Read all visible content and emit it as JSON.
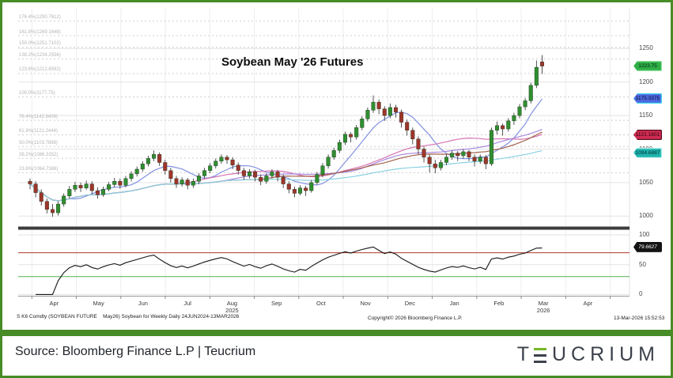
{
  "title": "Soybean May '26 Futures",
  "chart_data": {
    "type": "candlestick",
    "title": "Soybean May '26 Futures",
    "instrument": "S K6 Comdty (SOYBEAN FUTURE)",
    "x_axis": {
      "months": [
        "Apr",
        "May",
        "Jun",
        "Jul",
        "Aug",
        "Sep",
        "Oct",
        "Nov",
        "Dec",
        "Jan",
        "Feb",
        "Mar",
        "Apr"
      ],
      "year_markers": [
        {
          "label": "2025",
          "month_index": 4
        },
        {
          "label": "2026",
          "month_index": 11
        }
      ]
    },
    "y_axis": {
      "ticks": [
        1250,
        1200,
        1150,
        1100,
        1050,
        1000
      ],
      "side": "right"
    },
    "fib_levels": [
      {
        "label": "176.4%(1290.7612)",
        "value": 1290.7612
      },
      {
        "label": "161.8%(1269.1648)",
        "value": 1269.1648
      },
      {
        "label": "150.0%(1251.7102)",
        "value": 1251.7102
      },
      {
        "label": "138.2%(1234.2556)",
        "value": 1234.2556
      },
      {
        "label": "123.6%(1212.6592)",
        "value": 1212.6592
      },
      {
        "label": "100.0%(1177.75)",
        "value": 1177.75
      },
      {
        "label": "76.4%(1142.8408)",
        "value": 1142.8408
      },
      {
        "label": "61.8%(1121.2444)",
        "value": 1121.2444
      },
      {
        "label": "50.0%(1103.7898)",
        "value": 1103.7898
      },
      {
        "label": "38.2%(1086.3352)",
        "value": 1086.3352
      },
      {
        "label": "23.6%(1064.7388)",
        "value": 1064.7388
      }
    ],
    "candle_colors": {
      "up": "#2f8f2f",
      "down": "#9e352a",
      "wick": "#2a2a2a"
    },
    "candles": [
      [
        1052,
        1056,
        1040,
        1048
      ],
      [
        1048,
        1052,
        1028,
        1035
      ],
      [
        1035,
        1040,
        1016,
        1022
      ],
      [
        1022,
        1026,
        1004,
        1010
      ],
      [
        1010,
        1018,
        999,
        1005
      ],
      [
        1005,
        1022,
        1001,
        1018
      ],
      [
        1018,
        1034,
        1014,
        1030
      ],
      [
        1030,
        1045,
        1026,
        1040
      ],
      [
        1040,
        1051,
        1036,
        1046
      ],
      [
        1046,
        1050,
        1036,
        1042
      ],
      [
        1042,
        1053,
        1039,
        1048
      ],
      [
        1048,
        1052,
        1033,
        1038
      ],
      [
        1038,
        1043,
        1026,
        1032
      ],
      [
        1032,
        1044,
        1029,
        1040
      ],
      [
        1040,
        1051,
        1037,
        1047
      ],
      [
        1047,
        1057,
        1043,
        1052
      ],
      [
        1052,
        1056,
        1041,
        1046
      ],
      [
        1046,
        1060,
        1043,
        1056
      ],
      [
        1056,
        1067,
        1052,
        1063
      ],
      [
        1063,
        1074,
        1059,
        1070
      ],
      [
        1070,
        1082,
        1066,
        1078
      ],
      [
        1078,
        1090,
        1074,
        1086
      ],
      [
        1086,
        1098,
        1082,
        1092
      ],
      [
        1092,
        1095,
        1075,
        1080
      ],
      [
        1080,
        1084,
        1062,
        1068
      ],
      [
        1068,
        1072,
        1050,
        1056
      ],
      [
        1056,
        1060,
        1042,
        1048
      ],
      [
        1048,
        1058,
        1044,
        1054
      ],
      [
        1054,
        1057,
        1040,
        1046
      ],
      [
        1046,
        1056,
        1042,
        1052
      ],
      [
        1052,
        1064,
        1048,
        1060
      ],
      [
        1060,
        1072,
        1056,
        1068
      ],
      [
        1068,
        1079,
        1064,
        1075
      ],
      [
        1075,
        1086,
        1071,
        1082
      ],
      [
        1082,
        1092,
        1078,
        1088
      ],
      [
        1088,
        1091,
        1078,
        1084
      ],
      [
        1084,
        1088,
        1070,
        1076
      ],
      [
        1076,
        1080,
        1062,
        1068
      ],
      [
        1068,
        1072,
        1054,
        1060
      ],
      [
        1060,
        1070,
        1056,
        1066
      ],
      [
        1066,
        1069,
        1052,
        1058
      ],
      [
        1058,
        1062,
        1046,
        1052
      ],
      [
        1052,
        1064,
        1048,
        1060
      ],
      [
        1060,
        1070,
        1056,
        1066
      ],
      [
        1066,
        1069,
        1052,
        1058
      ],
      [
        1058,
        1062,
        1042,
        1048
      ],
      [
        1048,
        1052,
        1034,
        1040
      ],
      [
        1040,
        1044,
        1028,
        1034
      ],
      [
        1034,
        1046,
        1031,
        1042
      ],
      [
        1042,
        1045,
        1030,
        1038
      ],
      [
        1038,
        1054,
        1035,
        1050
      ],
      [
        1050,
        1066,
        1047,
        1062
      ],
      [
        1062,
        1079,
        1058,
        1075
      ],
      [
        1075,
        1092,
        1071,
        1088
      ],
      [
        1088,
        1102,
        1084,
        1098
      ],
      [
        1098,
        1114,
        1094,
        1110
      ],
      [
        1110,
        1126,
        1106,
        1122
      ],
      [
        1122,
        1125,
        1110,
        1118
      ],
      [
        1118,
        1136,
        1114,
        1132
      ],
      [
        1132,
        1149,
        1128,
        1145
      ],
      [
        1145,
        1162,
        1141,
        1158
      ],
      [
        1158,
        1180,
        1154,
        1170
      ],
      [
        1170,
        1174,
        1152,
        1160
      ],
      [
        1160,
        1164,
        1142,
        1150
      ],
      [
        1150,
        1168,
        1146,
        1162
      ],
      [
        1162,
        1166,
        1147,
        1155
      ],
      [
        1155,
        1159,
        1132,
        1140
      ],
      [
        1140,
        1144,
        1120,
        1128
      ],
      [
        1128,
        1132,
        1107,
        1115
      ],
      [
        1115,
        1119,
        1092,
        1100
      ],
      [
        1100,
        1104,
        1080,
        1088
      ],
      [
        1088,
        1092,
        1065,
        1078
      ],
      [
        1078,
        1084,
        1064,
        1072
      ],
      [
        1072,
        1084,
        1068,
        1080
      ],
      [
        1080,
        1092,
        1076,
        1088
      ],
      [
        1088,
        1098,
        1084,
        1094
      ],
      [
        1094,
        1097,
        1082,
        1090
      ],
      [
        1090,
        1100,
        1086,
        1096
      ],
      [
        1096,
        1099,
        1082,
        1088
      ],
      [
        1088,
        1092,
        1074,
        1082
      ],
      [
        1082,
        1092,
        1078,
        1088
      ],
      [
        1088,
        1091,
        1070,
        1078
      ],
      [
        1078,
        1132,
        1075,
        1128
      ],
      [
        1128,
        1141,
        1122,
        1135
      ],
      [
        1135,
        1138,
        1120,
        1130
      ],
      [
        1130,
        1146,
        1126,
        1142
      ],
      [
        1142,
        1154,
        1136,
        1150
      ],
      [
        1150,
        1167,
        1146,
        1163
      ],
      [
        1163,
        1176,
        1158,
        1172
      ],
      [
        1172,
        1199,
        1168,
        1195
      ],
      [
        1195,
        1232,
        1191,
        1222
      ],
      [
        1230,
        1240,
        1212,
        1223.75
      ]
    ],
    "moving_averages": [
      {
        "name": "ma-8wk",
        "window": 8,
        "color": "#8292e2"
      },
      {
        "name": "ma-26wk",
        "window": 26,
        "color": "#d773b5"
      },
      {
        "name": "ma-34wk",
        "window": 34,
        "color": "#a98ae0"
      },
      {
        "name": "ma-40wk",
        "window": 40,
        "color": "#a2614b"
      },
      {
        "name": "ma-70wk",
        "window": 70,
        "color": "#8ad1e4"
      }
    ],
    "price_chips": {
      "last": {
        "text": "1223.75",
        "value": 1223.75,
        "bg": "#2fae47",
        "border": "#8ee29a",
        "fg": "#05230b"
      },
      "ma_fast": {
        "text": "1175.3375",
        "value": 1175.3375,
        "bg": "#4c67de",
        "border": "#3fd9f2",
        "fg": "#0a1033"
      },
      "ma_mid": {
        "text": "1121.1801",
        "value": 1121.1801,
        "bg": "#cf2b52",
        "border": "#58101f",
        "fg": "#20040a"
      },
      "ma_slow": {
        "text": "1094.6887",
        "value": 1094.6887,
        "bg": "#1fb3ae",
        "border": "#a8efe7",
        "fg": "#043230"
      }
    },
    "oscillator": {
      "type": "RSI",
      "period": 14,
      "ticks": [
        100,
        50,
        0
      ],
      "overbought": 70,
      "oversold": 30,
      "line_color": "#151515",
      "overbought_color": "#b03a2a",
      "oversold_color": "#55b055",
      "chip": {
        "text": "79.6627",
        "value": 79.6627,
        "bg": "#141414",
        "fg": "#ffffff"
      }
    },
    "grid": {
      "vertical_color": "#ededed",
      "horizontal_color": "#e3e3e3",
      "fib_color": "#cdcdcd",
      "axis_color": "#999999"
    }
  },
  "bbg_footer": {
    "left": "S K6 Comdty (SOYBEAN FUTURE    May26) Soybean for Weekly Daily 24JUN2024-13MAR2026",
    "center": "Copyright© 2026 Bloomberg Finance L.P.",
    "right": "13-Mar-2026 15:52:53"
  },
  "source_bar": {
    "text": "Source: Bloomberg Finance L.P | Teucrium",
    "logo_t": "T",
    "logo_rest": "UCRIUM",
    "logo_accent_color": "#76b82a"
  }
}
